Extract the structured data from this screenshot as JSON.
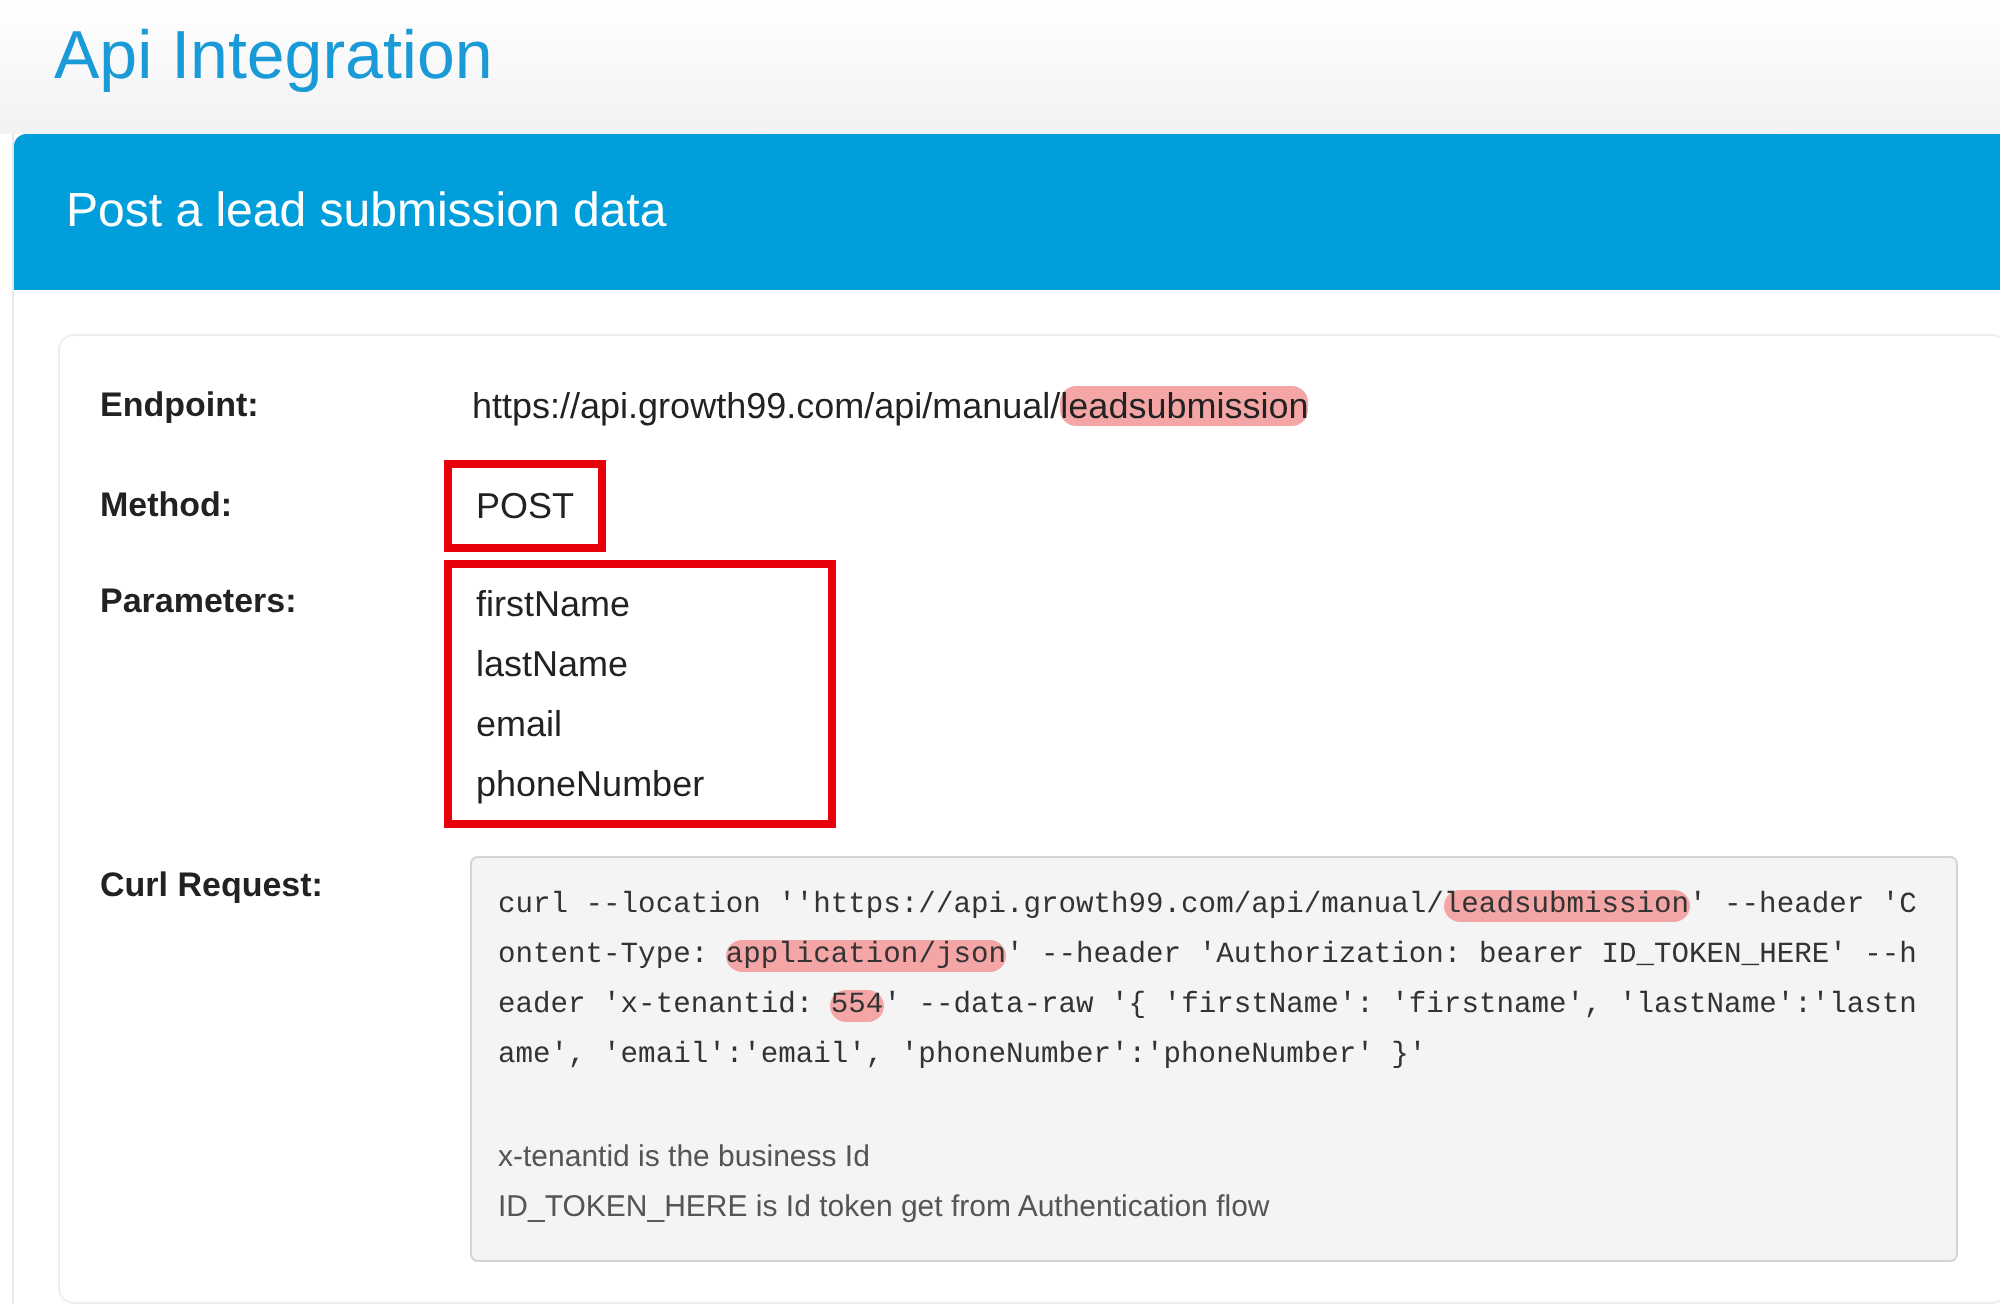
{
  "page_title": "Api Integration",
  "panel": {
    "title": "Post a lead submission data",
    "endpoint": {
      "label": "Endpoint:",
      "value": [
        {
          "text": "https://api.growth99.com/api/manual/",
          "highlighted": false
        },
        {
          "text": "leadsubmission",
          "highlighted": true
        }
      ]
    },
    "method": {
      "label": "Method:",
      "value": "POST",
      "outlined": true
    },
    "parameters": {
      "label": "Parameters:",
      "items": [
        "firstName",
        "lastName",
        "email",
        "phoneNumber"
      ],
      "outlined": true
    },
    "curl": {
      "label": "Curl Request:",
      "code": [
        {
          "text": "curl --location ''https://api.growth99.com/api/manual/",
          "highlighted": false
        },
        {
          "text": "leadsubmission",
          "highlighted": true
        },
        {
          "text": "' --header 'Content-Type: ",
          "highlighted": false
        },
        {
          "text": "application/json",
          "highlighted": true
        },
        {
          "text": "' --header 'Authorization: bearer ID_TOKEN_HERE' --header 'x-tenantid: ",
          "highlighted": false
        },
        {
          "text": "554",
          "highlighted": true
        },
        {
          "text": "' --data-raw '{ 'firstName': 'firstname', 'lastName':'lastname', 'email':'email', 'phoneNumber':'phoneNumber' }'",
          "highlighted": false
        }
      ],
      "notes": [
        "x-tenantid is the business Id",
        "ID_TOKEN_HERE is Id token get from Authentication flow"
      ]
    }
  }
}
